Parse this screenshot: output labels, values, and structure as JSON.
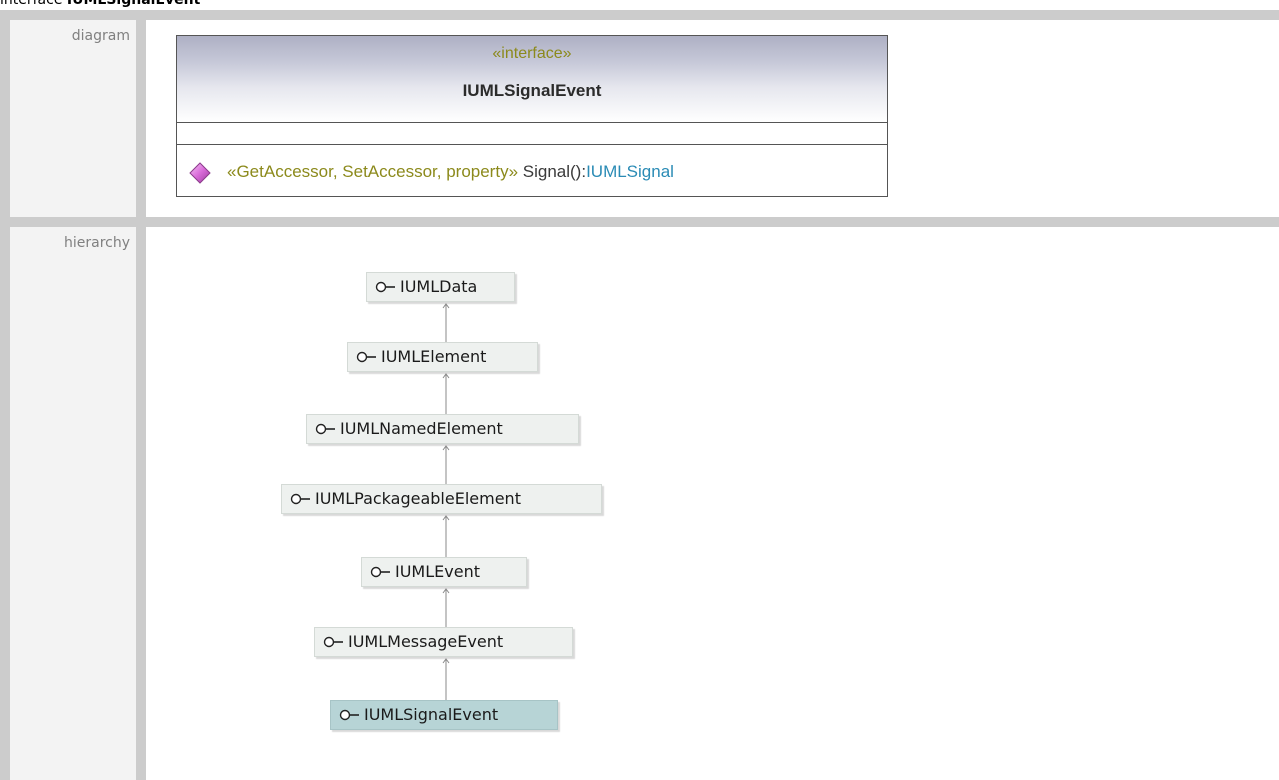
{
  "page": {
    "kind": "interface",
    "name": "IUMLSignalEvent"
  },
  "rows": {
    "diagram_label": "diagram",
    "hierarchy_label": "hierarchy"
  },
  "uml_class": {
    "stereotype": "«interface»",
    "name": "IUMLSignalEvent",
    "operation": {
      "icon": "operation-diamond-icon",
      "stereotypes": "«GetAccessor, SetAccessor, property»",
      "signature": " Signal():",
      "return_type": "IUMLSignal"
    }
  },
  "hierarchy": [
    {
      "label": "IUMLData",
      "current": false
    },
    {
      "label": "IUMLElement",
      "current": false
    },
    {
      "label": "IUMLNamedElement",
      "current": false
    },
    {
      "label": "IUMLPackageableElement",
      "current": false
    },
    {
      "label": "IUMLEvent",
      "current": false
    },
    {
      "label": "IUMLMessageEvent",
      "current": false
    },
    {
      "label": "IUMLSignalEvent",
      "current": true
    }
  ],
  "colors": {
    "stereotype": "#8c8a1c",
    "type_link": "#2a8bb5",
    "operation_icon": "#d96bd9",
    "current_node": "#b7d4d6"
  }
}
